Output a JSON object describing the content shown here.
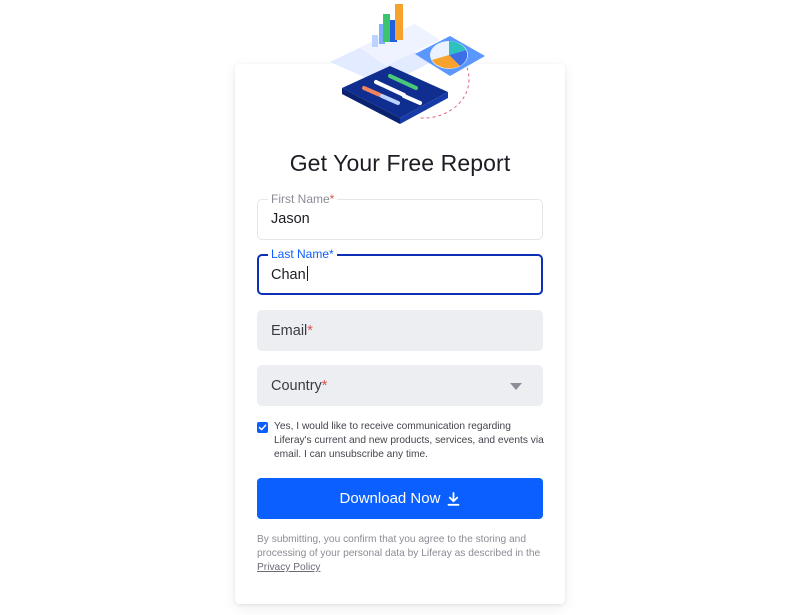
{
  "form": {
    "title": "Get Your Free Report",
    "first_name": {
      "label": "First Name",
      "required_mark": "*",
      "value": "Jason"
    },
    "last_name": {
      "label": "Last Name",
      "required_mark": "*",
      "value": "Chan"
    },
    "email": {
      "placeholder": "Email",
      "required_mark": "*"
    },
    "country": {
      "placeholder": "Country",
      "required_mark": "*"
    },
    "consent": {
      "checked": true,
      "text": "Yes, I would like to receive communication regarding Liferay's current and new products, services, and events via email. I can unsubscribe any time."
    },
    "submit_label": "Download Now",
    "footnote": {
      "text": "By submitting, you confirm that you agree to the storing and processing of your personal data by Liferay as described in the ",
      "link_label": "Privacy Policy"
    }
  },
  "colors": {
    "primary": "#0b5fff",
    "focus_border": "#0b2fb5",
    "required": "#d9534f",
    "field_fill": "#eceef2"
  },
  "icons": {
    "checkbox": "checkmark-icon",
    "submit": "download-icon",
    "country": "chevron-down-icon"
  }
}
